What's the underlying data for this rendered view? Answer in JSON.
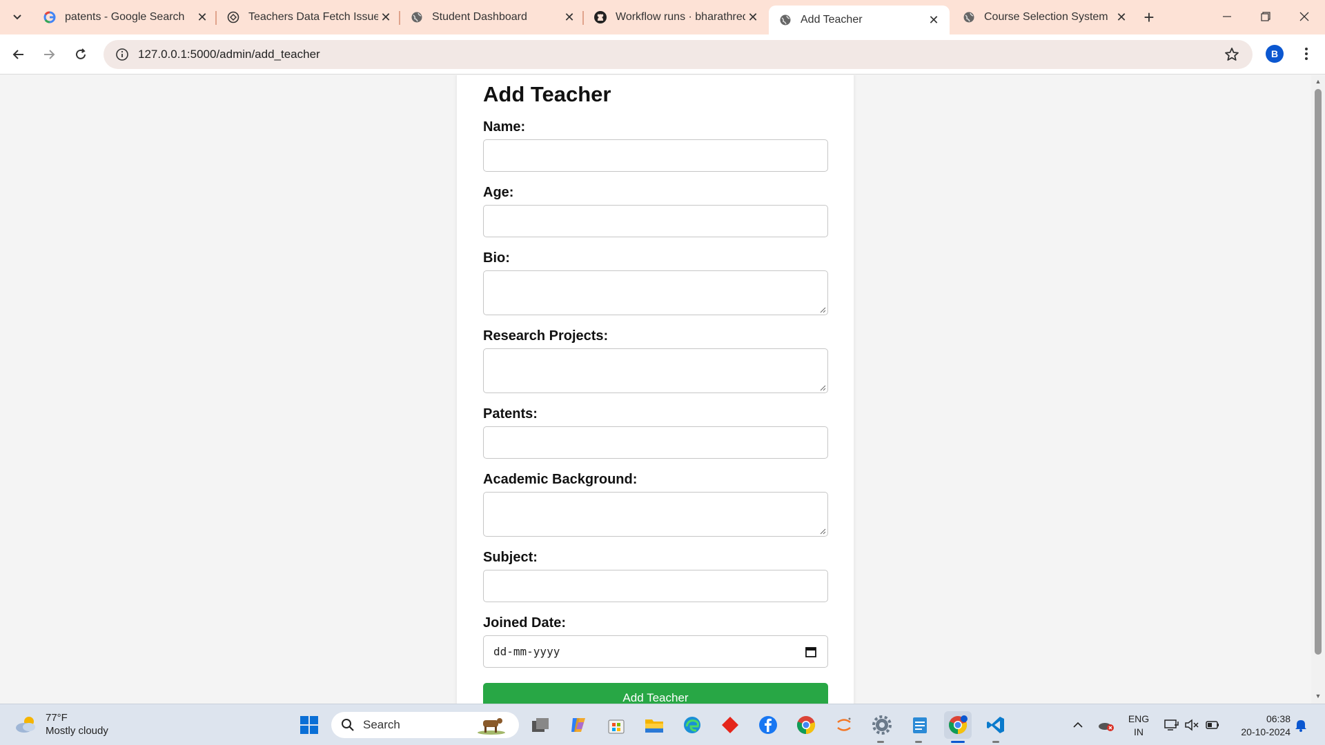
{
  "browser": {
    "tabs": [
      {
        "title": "patents - Google Search",
        "icon": "google-icon"
      },
      {
        "title": "Teachers Data Fetch Issue",
        "icon": "chatgpt-icon"
      },
      {
        "title": "Student Dashboard",
        "icon": "globe-icon"
      },
      {
        "title": "Workflow runs · bharathreddy",
        "icon": "github-icon"
      },
      {
        "title": "Add Teacher",
        "icon": "globe-icon",
        "active": true
      },
      {
        "title": "Course Selection System",
        "icon": "globe-icon"
      }
    ],
    "url": "127.0.0.1:5000/admin/add_teacher",
    "profile_initial": "B"
  },
  "form": {
    "title": "Add Teacher",
    "fields": [
      {
        "label": "Name:",
        "type": "text",
        "value": ""
      },
      {
        "label": "Age:",
        "type": "number",
        "value": ""
      },
      {
        "label": "Bio:",
        "type": "textarea",
        "value": ""
      },
      {
        "label": "Research Projects:",
        "type": "textarea",
        "value": ""
      },
      {
        "label": "Patents:",
        "type": "text",
        "value": ""
      },
      {
        "label": "Academic Background:",
        "type": "textarea",
        "value": ""
      },
      {
        "label": "Subject:",
        "type": "text",
        "value": ""
      },
      {
        "label": "Joined Date:",
        "type": "date",
        "value": "dd-mm-yyyy"
      }
    ],
    "submit_label": "Add Teacher",
    "submit_color": "#28a745"
  },
  "taskbar": {
    "weather_temp": "77°F",
    "weather_desc": "Mostly cloudy",
    "search_placeholder": "Search",
    "lang_line1": "ENG",
    "lang_line2": "IN",
    "time": "06:38",
    "date": "20-10-2024"
  }
}
